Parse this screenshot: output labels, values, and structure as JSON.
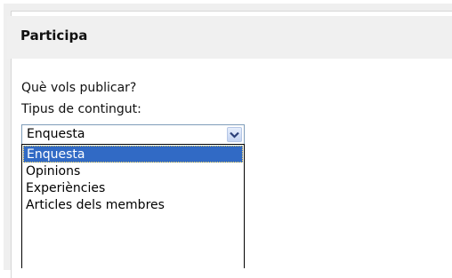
{
  "panel": {
    "title": "Participa",
    "question": "Què vols publicar?",
    "content_type_label": "Tipus de contingut:"
  },
  "dropdown": {
    "selected": "Enquesta",
    "arrow_icon": "chevron-down-icon",
    "options": [
      {
        "label": "Enquesta",
        "highlighted": true
      },
      {
        "label": "Opinions",
        "highlighted": false
      },
      {
        "label": "Experiències",
        "highlighted": false
      },
      {
        "label": "Articles dels membres",
        "highlighted": false
      }
    ]
  },
  "colors": {
    "highlight": "#316ac5",
    "header_bg": "#f0f0f0",
    "select_border": "#7f9db9"
  }
}
